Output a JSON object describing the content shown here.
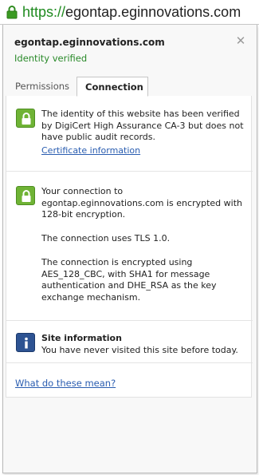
{
  "address_bar": {
    "scheme": "https://",
    "host": "egontap.eginnovations.com",
    "lock_icon": "padlock-icon",
    "scheme_color": "#1e8a1e"
  },
  "popup": {
    "site_host": "egontap.eginnovations.com",
    "identity_status": "Identity verified",
    "identity_color": "#2a8a2a",
    "close_icon": "close-icon",
    "tabs": [
      {
        "label": "Permissions",
        "selected": false
      },
      {
        "label": "Connection",
        "selected": true
      }
    ],
    "sections": {
      "identity": {
        "icon": "green-lock-icon",
        "text": "The identity of this website has been verified by DigiCert High Assurance CA-3 but does not have public audit records.",
        "link": "Certificate information"
      },
      "connection": {
        "icon": "green-lock-icon",
        "text_1": "Your connection to egontap.eginnovations.com is encrypted with 128-bit encryption.",
        "text_2": "The connection uses TLS 1.0.",
        "text_3": "The connection is encrypted using AES_128_CBC, with SHA1 for message authentication and DHE_RSA as the key exchange mechanism."
      },
      "site_info": {
        "icon": "info-icon",
        "title": "Site information",
        "text": "You have never visited this site before today."
      }
    },
    "help_link": "What do these mean?"
  }
}
